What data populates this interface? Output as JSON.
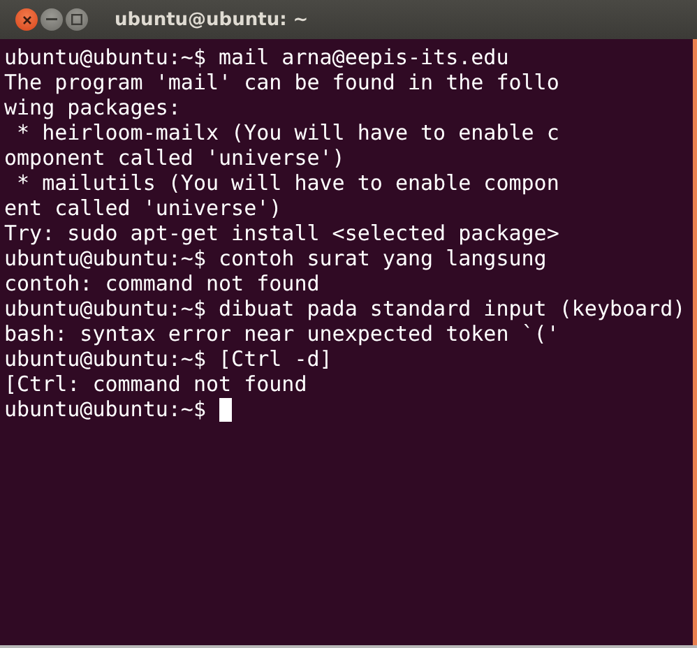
{
  "window": {
    "title": "ubuntu@ubuntu: ~"
  },
  "terminal": {
    "lines": [
      {
        "text": "ubuntu@ubuntu:~$ mail arna@eepis-its.edu",
        "cursor": false
      },
      {
        "text": "The program 'mail' can be found in the follo",
        "cursor": false
      },
      {
        "text": "wing packages:",
        "cursor": false
      },
      {
        "text": " * heirloom-mailx (You will have to enable c",
        "cursor": false
      },
      {
        "text": "omponent called 'universe')",
        "cursor": false
      },
      {
        "text": " * mailutils (You will have to enable compon",
        "cursor": false
      },
      {
        "text": "ent called 'universe')",
        "cursor": false
      },
      {
        "text": "Try: sudo apt-get install <selected package>",
        "cursor": false
      },
      {
        "text": "ubuntu@ubuntu:~$ contoh surat yang langsung",
        "cursor": false
      },
      {
        "text": "contoh: command not found",
        "cursor": false
      },
      {
        "text": "ubuntu@ubuntu:~$ dibuat pada standard input (keyboard)",
        "cursor": false
      },
      {
        "text": "bash: syntax error near unexpected token `('",
        "cursor": false
      },
      {
        "text": "ubuntu@ubuntu:~$ [Ctrl -d]",
        "cursor": false
      },
      {
        "text": "[Ctrl: command not found",
        "cursor": false
      },
      {
        "text": "ubuntu@ubuntu:~$",
        "cursor": true
      }
    ]
  }
}
